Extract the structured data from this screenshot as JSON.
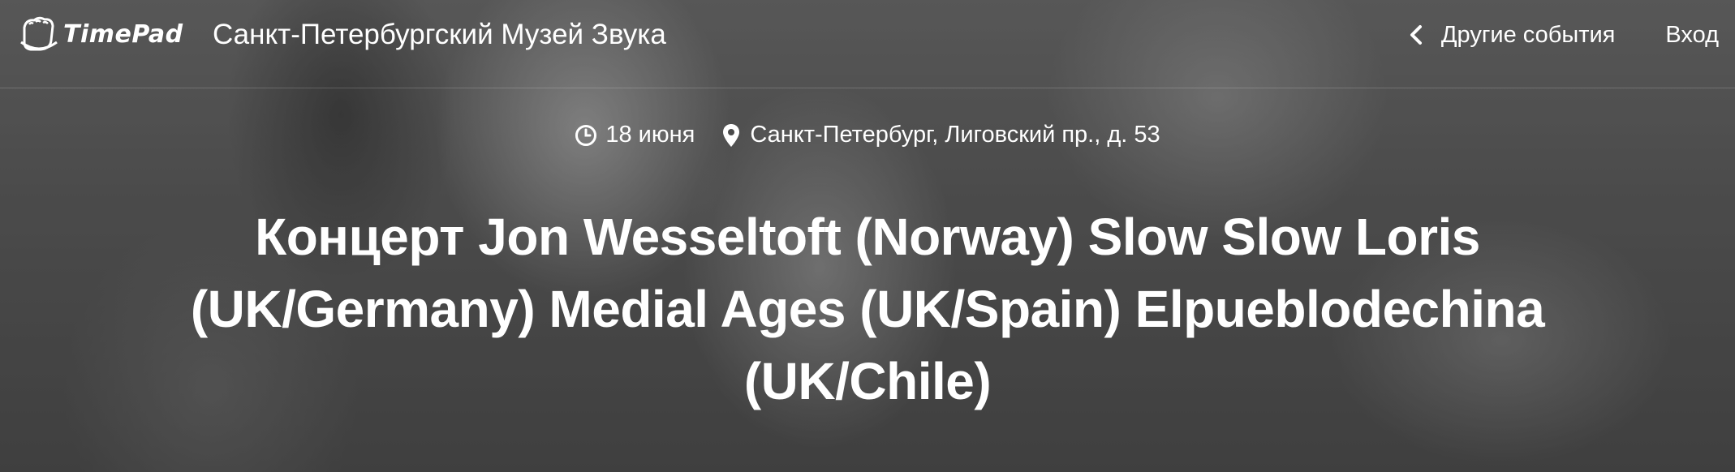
{
  "brand": {
    "logo_text": "TimePad"
  },
  "header": {
    "org_title": "Санкт-Петербургский Музей Звука",
    "other_events_label": "Другие события",
    "login_label": "Вход"
  },
  "event": {
    "date": "18 июня",
    "address": "Санкт-Петербург, Лиговский пр., д. 53",
    "title": "Концерт Jon Wesseltoft (Norway) Slow Slow Loris (UK/Germany) Medial Ages (UK/Spain) Elpueblodechina (UK/Chile)"
  },
  "icons": {
    "logo": "timepad-logo-icon",
    "back": "chevron-left-icon",
    "date": "clock-icon",
    "location": "map-pin-icon"
  },
  "colors": {
    "text": "#ffffff",
    "overlay": "#3d3d3d"
  }
}
